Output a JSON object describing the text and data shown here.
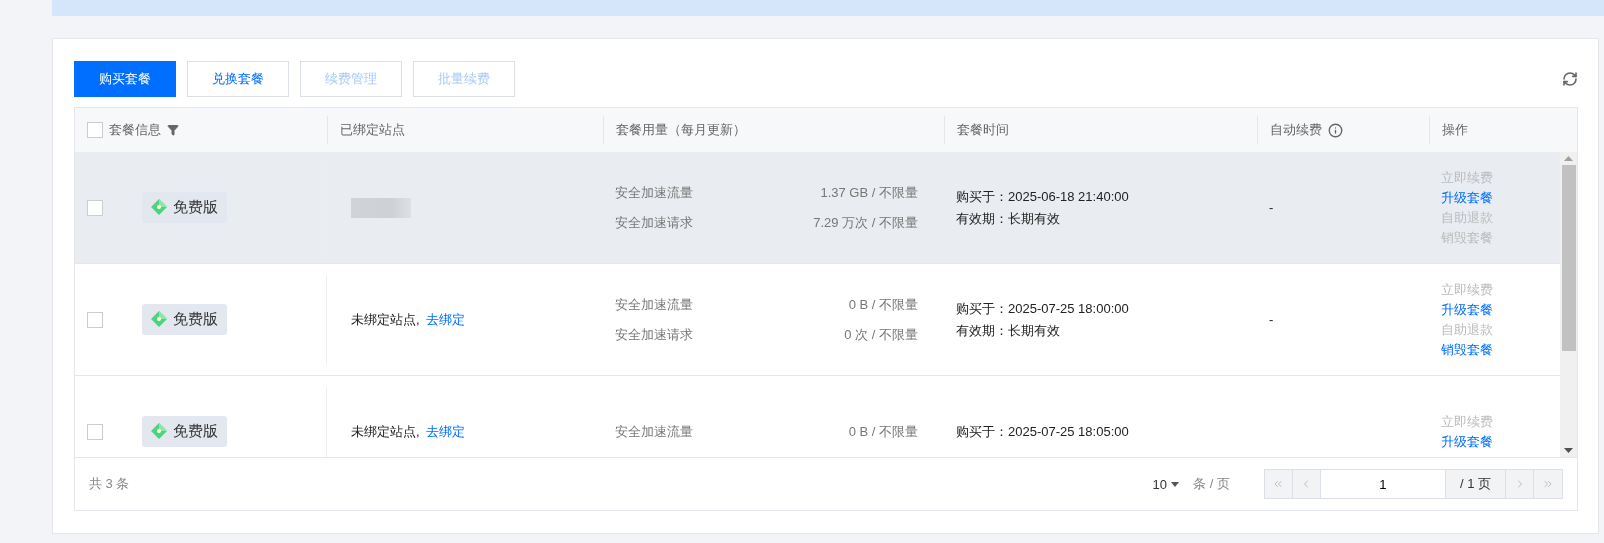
{
  "toolbar": {
    "buttons": [
      {
        "label": "购买套餐",
        "kind": "primary",
        "disabled": false
      },
      {
        "label": "兑换套餐",
        "kind": "default",
        "disabled": false
      },
      {
        "label": "续费管理",
        "kind": "default",
        "disabled": true
      },
      {
        "label": "批量续费",
        "kind": "default",
        "disabled": true
      }
    ]
  },
  "table": {
    "select_all": {
      "checked": false
    },
    "columns": [
      {
        "label": "套餐信息",
        "kind": "filter"
      },
      {
        "label": "已绑定站点",
        "kind": "plain"
      },
      {
        "label": "套餐用量（每月更新）",
        "kind": "plain"
      },
      {
        "label": "套餐时间",
        "kind": "plain"
      },
      {
        "label": "自动续费",
        "kind": "info"
      },
      {
        "label": "操作",
        "kind": "plain"
      }
    ],
    "rows": [
      {
        "checked": false,
        "highlighted": true,
        "plan": "免费版",
        "site": {
          "kind": "blurred"
        },
        "usage": [
          {
            "label": "安全加速流量",
            "value": "1.37 GB / 不限量"
          },
          {
            "label": "安全加速请求",
            "value": "7.29 万次 / 不限量"
          }
        ],
        "purchased": "购买于：2025-06-18 21:40:00",
        "validity": "有效期：长期有效",
        "auto_renew": "-",
        "actions": [
          {
            "label": "立即续费",
            "disabled": true
          },
          {
            "label": "升级套餐",
            "disabled": false
          },
          {
            "label": "自助退款",
            "disabled": true
          },
          {
            "label": "销毁套餐",
            "disabled": true
          }
        ]
      },
      {
        "checked": false,
        "highlighted": false,
        "plan": "免费版",
        "site": {
          "kind": "unbound",
          "text": "未绑定站点,",
          "link": "去绑定"
        },
        "usage": [
          {
            "label": "安全加速流量",
            "value": "0 B / 不限量"
          },
          {
            "label": "安全加速请求",
            "value": "0 次 / 不限量"
          }
        ],
        "purchased": "购买于：2025-07-25 18:00:00",
        "validity": "有效期：长期有效",
        "auto_renew": "-",
        "actions": [
          {
            "label": "立即续费",
            "disabled": true
          },
          {
            "label": "升级套餐",
            "disabled": false
          },
          {
            "label": "自助退款",
            "disabled": true
          },
          {
            "label": "销毁套餐",
            "disabled": false
          }
        ]
      },
      {
        "checked": false,
        "highlighted": false,
        "plan": "免费版",
        "site": {
          "kind": "unbound",
          "text": "未绑定站点,",
          "link": "去绑定"
        },
        "usage": [
          {
            "label": "安全加速流量",
            "value": "0 B / 不限量"
          }
        ],
        "purchased": "购买于：2025-07-25 18:05:00",
        "actions": [
          {
            "label": "立即续费",
            "disabled": true
          },
          {
            "label": "升级套餐",
            "disabled": false
          }
        ]
      }
    ]
  },
  "footer": {
    "total": "共 3 条",
    "page_size": "10",
    "page_size_unit": "条 / 页",
    "page": "1",
    "page_total": "/ 1 页"
  }
}
